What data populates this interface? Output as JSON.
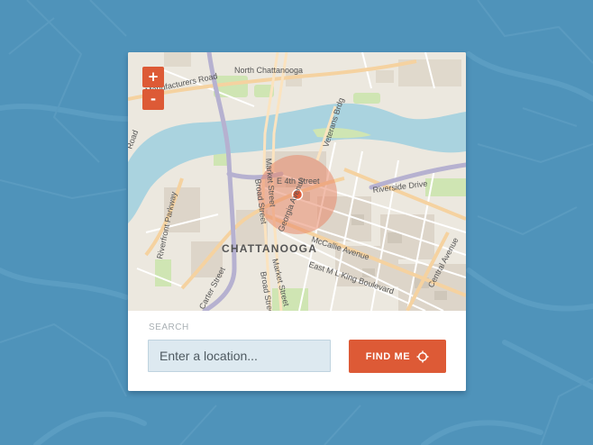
{
  "colors": {
    "background": "#4f93ba",
    "accent": "#dd5a36",
    "input_fill": "#dde9f0",
    "river": "#aad3df",
    "radius_circle": "#e8886a"
  },
  "map": {
    "zoom_in_label": "+",
    "zoom_out_label": "-",
    "labels": {
      "manufacturers_road": "Manufacturers Road",
      "north_chattanooga": "North Chattanooga",
      "veterans_bridge": "Veterans Brdg",
      "e_4th_street": "E 4th Street",
      "riverside_drive": "Riverside Drive",
      "market_street_north": "Market Street",
      "broad_street_north": "Broad Street",
      "georgia_avenue": "Georgia Avenue",
      "riverfront_parkway": "Riverfront Parkway",
      "chattanooga": "CHATTANOOGA",
      "mccallie_avenue": "McCallie Avenue",
      "east_mlk_boulevard": "East M L King Boulevard",
      "central_avenue": "Central Avenue",
      "carter_street": "Carter Street",
      "broad_street_south": "Broad Street",
      "market_street_south": "Market Street",
      "road_edge": "Road"
    },
    "icons": {
      "zoom_in": "plus-icon",
      "zoom_out": "minus-icon",
      "location_marker": "location-dot-icon"
    }
  },
  "search": {
    "label": "SEARCH",
    "placeholder": "Enter a location...",
    "value": "",
    "button_label": "FIND ME",
    "button_icon": "crosshair-icon"
  }
}
